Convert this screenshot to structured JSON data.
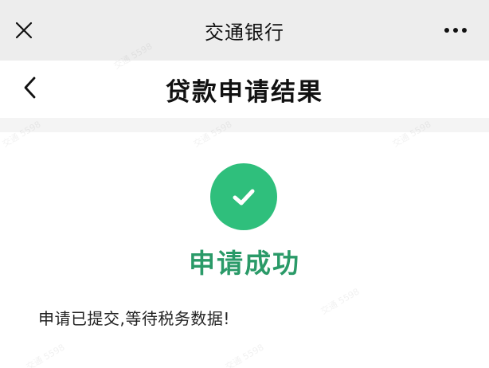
{
  "topbar": {
    "title": "交通银行",
    "close_icon": "close-icon",
    "more_icon": "more-dots-icon"
  },
  "navbar": {
    "back_icon": "chevron-left-icon",
    "title": "贷款申请结果"
  },
  "result": {
    "icon": "check-icon",
    "status": "申请成功",
    "message": "申请已提交,等待税务数据!"
  },
  "watermark": "交通 5598",
  "colors": {
    "topbar_bg": "#ededed",
    "success_green": "#2fbf7c",
    "status_text": "#2a9a68"
  }
}
